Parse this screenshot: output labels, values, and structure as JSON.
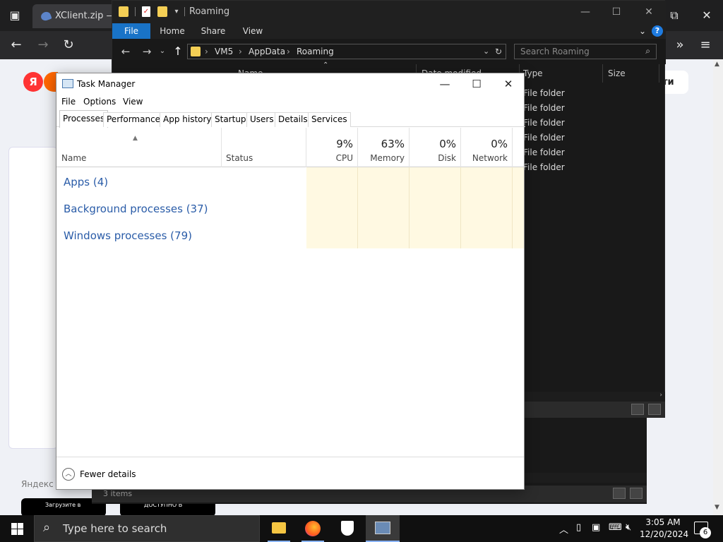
{
  "browser": {
    "tab_title": "XClient.zip — Я",
    "button_partial": "ти",
    "footer_partial": "Яндекс",
    "appstore_small": "Загрузите в",
    "googleplay_small": "ДОСТУПНО В"
  },
  "explorer": {
    "title": "Roaming",
    "ribbon": {
      "file": "File",
      "home": "Home",
      "share": "Share",
      "view": "View"
    },
    "path": [
      "VM5",
      "AppData",
      "Roaming"
    ],
    "search_placeholder": "Search Roaming",
    "columns": {
      "name": "Name",
      "date": "Date modified",
      "type": "Type",
      "size": "Size"
    },
    "rows": [
      "File folder",
      "File folder",
      "File folder",
      "File folder",
      "File folder",
      "File folder"
    ],
    "status_items": "3 items"
  },
  "task_manager": {
    "title": "Task Manager",
    "menu": {
      "file": "File",
      "options": "Options",
      "view": "View"
    },
    "tabs": [
      "Processes",
      "Performance",
      "App history",
      "Startup",
      "Users",
      "Details",
      "Services"
    ],
    "columns": {
      "name": "Name",
      "status": "Status",
      "cpu": {
        "pct": "9%",
        "label": "CPU"
      },
      "memory": {
        "pct": "63%",
        "label": "Memory"
      },
      "disk": {
        "pct": "0%",
        "label": "Disk"
      },
      "network": {
        "pct": "0%",
        "label": "Network"
      }
    },
    "groups": [
      "Apps (4)",
      "Background processes (37)",
      "Windows processes (79)"
    ],
    "fewer_details": "Fewer details"
  },
  "taskbar": {
    "search_placeholder": "Type here to search",
    "time": "3:05 AM",
    "date": "12/20/2024",
    "notifications": "6"
  },
  "colors": {
    "accent": "#1973c7",
    "link": "#2a5ca8",
    "heat": "#fff9e2",
    "taskbar": "#101010"
  }
}
